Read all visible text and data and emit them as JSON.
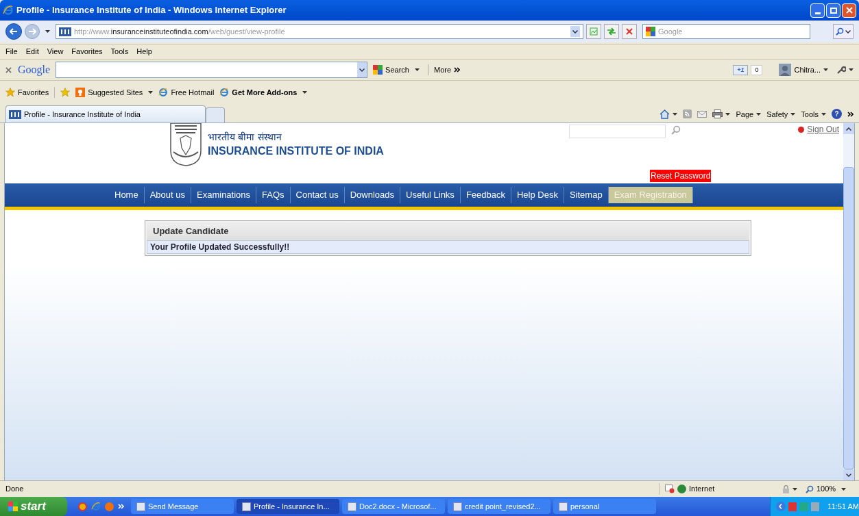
{
  "window": {
    "title": "Profile - Insurance Institute of India - Windows Internet Explorer"
  },
  "address_bar": {
    "url_prefix": "http://www.",
    "url_domain": "insuranceinstituteofindia.com",
    "url_path": "/web/guest/view-profile",
    "search_placeholder": "Google"
  },
  "menu_bar": [
    "File",
    "Edit",
    "View",
    "Favorites",
    "Tools",
    "Help"
  ],
  "google_toolbar": {
    "logo": "Google",
    "search_button": "Search",
    "more_button": "More",
    "plus_one": "+1",
    "plus_count": "0",
    "user": "Chitra..."
  },
  "favorites_bar": {
    "favorites": "Favorites",
    "items": [
      {
        "label": "Suggested Sites",
        "kind": "menu"
      },
      {
        "label": "Free Hotmail",
        "kind": "link"
      },
      {
        "label": "Get More Add-ons",
        "kind": "bold-menu"
      }
    ]
  },
  "tab": {
    "title": "Profile - Insurance Institute of India"
  },
  "command_bar": [
    "Page",
    "Safety",
    "Tools"
  ],
  "help_glyph": "?",
  "page": {
    "hindi_name": "भारतीय बीमा संस्थान",
    "english_name": "INSURANCE INSTITUTE OF INDIA",
    "sign_out": "Sign Out",
    "reset_password": "Reset Password",
    "nav": [
      {
        "label": "Home",
        "selected": false
      },
      {
        "label": "About us",
        "selected": false
      },
      {
        "label": "Examinations",
        "selected": false
      },
      {
        "label": "FAQs",
        "selected": false
      },
      {
        "label": "Contact us",
        "selected": false
      },
      {
        "label": "Downloads",
        "selected": false
      },
      {
        "label": "Useful Links",
        "selected": false
      },
      {
        "label": "Feedback",
        "selected": false
      },
      {
        "label": "Help Desk",
        "selected": false
      },
      {
        "label": "Sitemap",
        "selected": false
      },
      {
        "label": "Exam Registration",
        "selected": true
      }
    ],
    "panel_title": "Update Candidate",
    "message": "Your Profile Updated Successfully!!"
  },
  "status_bar": {
    "status": "Done",
    "zone": "Internet",
    "zoom": "100%"
  },
  "taskbar": {
    "start": "start",
    "tasks": [
      {
        "label": "Send Message",
        "selected": false
      },
      {
        "label": "Profile - Insurance In...",
        "selected": true
      },
      {
        "label": "Doc2.docx - Microsof...",
        "selected": false
      },
      {
        "label": "credit point_revised2...",
        "selected": false
      },
      {
        "label": "personal",
        "selected": false
      }
    ],
    "clock": "11:51 AM"
  }
}
